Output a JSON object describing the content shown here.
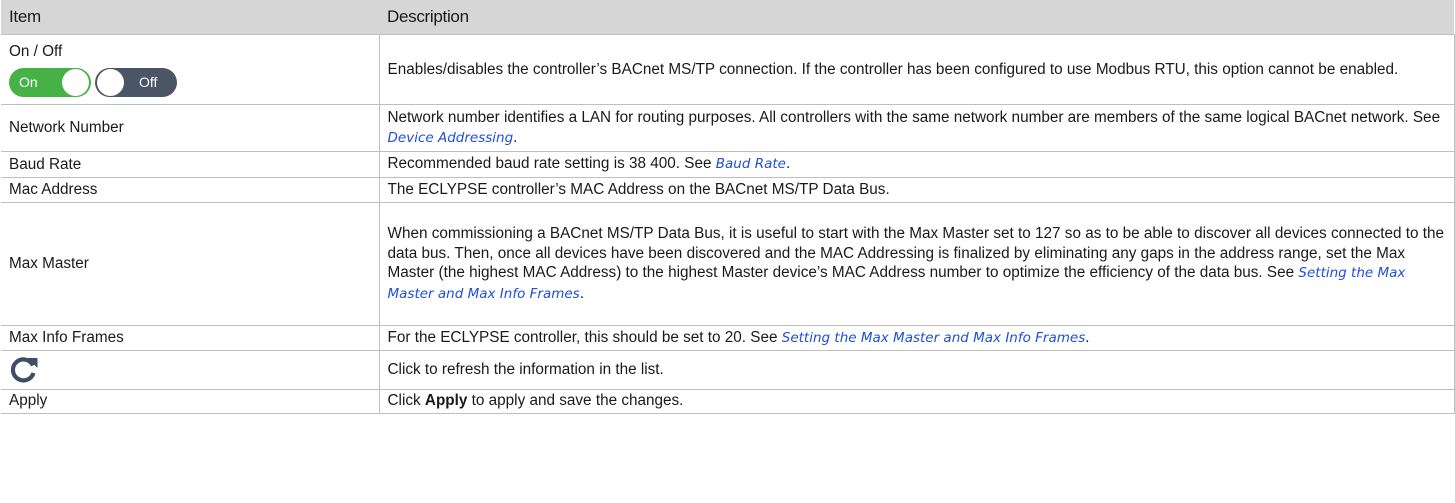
{
  "header": {
    "item": "Item",
    "description": "Description"
  },
  "rows": [
    {
      "item": "On / Off",
      "toggle_on_label": "On",
      "toggle_off_label": "Off",
      "description": "Enables/disables the controller’s BACnet MS/TP connection. If the controller has been configured to use Modbus RTU, this option cannot be enabled."
    },
    {
      "item": "Network Number",
      "description_pre": "Network number identifies a LAN for routing purposes. All controllers with the same network number are members of the same logical BACnet network. See ",
      "link": "Device Addressing",
      "description_post": "."
    },
    {
      "item": "Baud Rate",
      "description_pre": "Recommended baud rate setting is 38 400. See ",
      "link": "Baud Rate",
      "description_post": "."
    },
    {
      "item": "Mac Address",
      "description": "The ECLYPSE controller’s MAC Address on the BACnet MS/TP Data Bus."
    },
    {
      "item": "Max Master",
      "description_pre": "When commissioning a BACnet MS/TP Data Bus, it is useful to start with the Max Master set to 127 so as to be able to discover all devices connected to the data bus. Then, once all devices have been discovered and the MAC Addressing is finalized by eliminating any gaps in the address range, set the Max Master (the highest MAC Address) to the highest Master device’s MAC Address number to optimize the efficiency of the data bus. See ",
      "link": "Setting the Max Master and Max Info Frames",
      "description_post": "."
    },
    {
      "item": "Max Info Frames",
      "description_pre": "For the ECLYPSE controller, this should be set to 20. See ",
      "link": "Setting the Max Master and Max Info Frames",
      "description_post": "."
    },
    {
      "item_icon": "refresh-icon",
      "description": "Click to refresh the information in the list."
    },
    {
      "item": "Apply",
      "description_pre": "Click ",
      "bold": "Apply",
      "description_post": " to apply and save the changes."
    }
  ],
  "colors": {
    "header_bg": "#d6d6d6",
    "border": "#bfbfbf",
    "link": "#1f4ed8",
    "toggle_on": "#46b245",
    "toggle_off": "#4a5566",
    "refresh_icon": "#3d4f66"
  }
}
